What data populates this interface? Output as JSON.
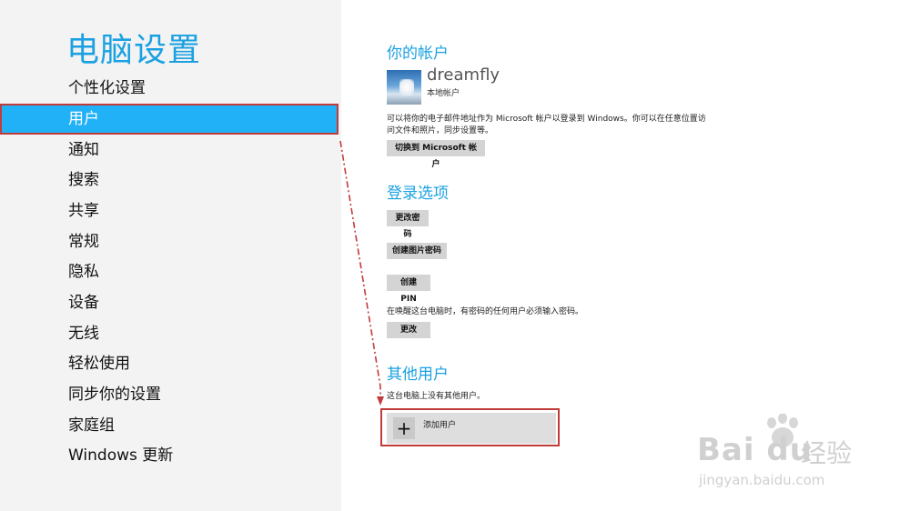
{
  "app": {
    "title": "电脑设置"
  },
  "nav": {
    "items": [
      {
        "label": "个性化设置",
        "selected": false
      },
      {
        "label": "用户",
        "selected": true
      },
      {
        "label": "通知",
        "selected": false
      },
      {
        "label": "搜索",
        "selected": false
      },
      {
        "label": "共享",
        "selected": false
      },
      {
        "label": "常规",
        "selected": false
      },
      {
        "label": "隐私",
        "selected": false
      },
      {
        "label": "设备",
        "selected": false
      },
      {
        "label": "无线",
        "selected": false
      },
      {
        "label": "轻松使用",
        "selected": false
      },
      {
        "label": "同步你的设置",
        "selected": false
      },
      {
        "label": "家庭组",
        "selected": false
      },
      {
        "label": "Windows 更新",
        "selected": false
      }
    ]
  },
  "account": {
    "section_title": "你的帐户",
    "username": "dreamfly",
    "account_type": "本地帐户",
    "description_line1": "可以将你的电子邮件地址作为 Microsoft 帐户以登录到 Windows。你可以在任意位置访",
    "description_line2": "问文件和照片，同步设置等。",
    "switch_button": "切换到 Microsoft 帐户"
  },
  "signin": {
    "section_title": "登录选项",
    "change_password_button": "更改密码",
    "picture_password_button": "创建图片密码",
    "pin_button": "创建 PIN",
    "wake_description": "在唤醒这台电脑时，有密码的任何用户必须输入密码。",
    "change_button": "更改"
  },
  "other_users": {
    "section_title": "其他用户",
    "empty_message": "这台电脑上没有其他用户。",
    "plus_glyph": "+",
    "add_user_label": "添加用户"
  },
  "watermark": {
    "logo_text": "Bai du",
    "brand_text": "经验",
    "url": "jingyan.baidu.com"
  },
  "colors": {
    "accent": "#1ba1e2",
    "selected_nav": "#20b1f7",
    "annotation_red": "#c23b3b"
  }
}
